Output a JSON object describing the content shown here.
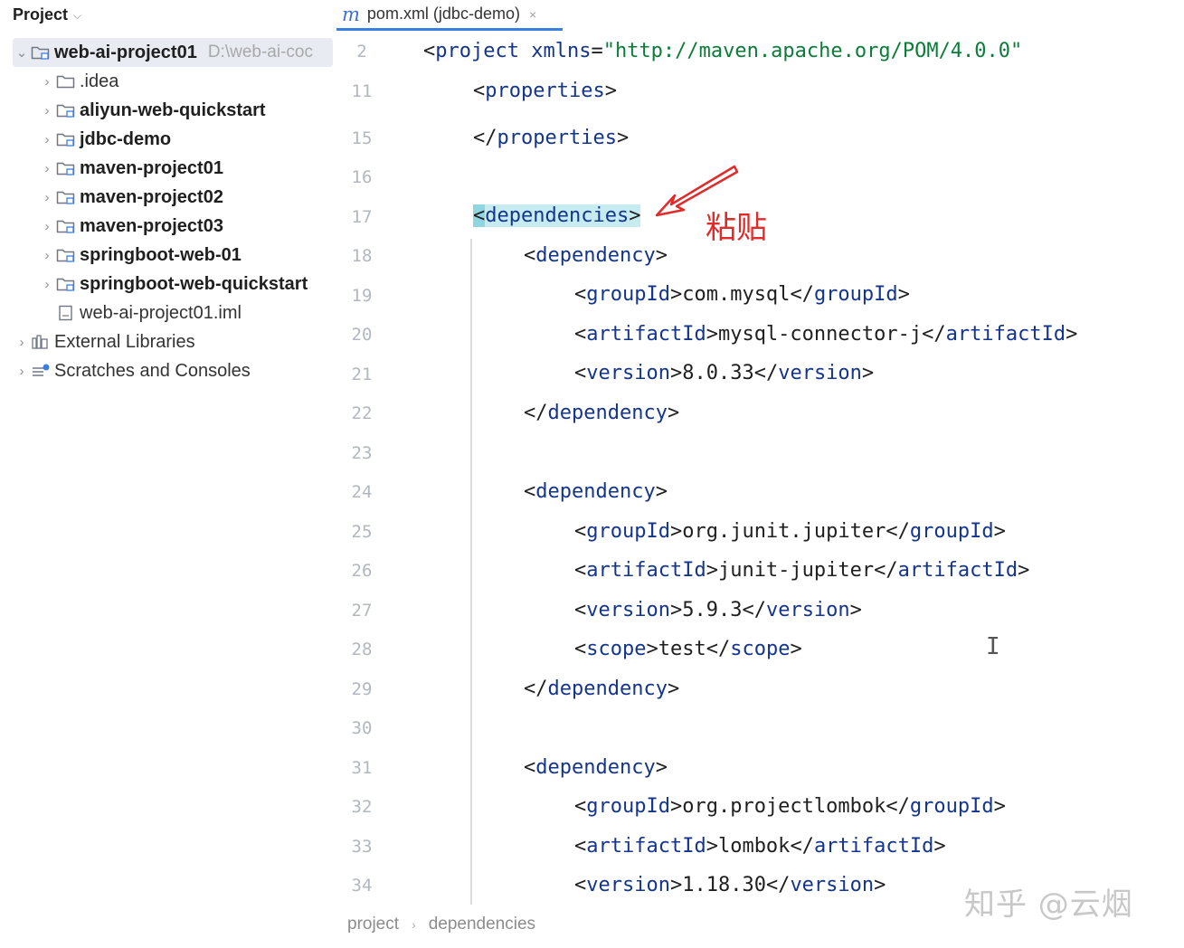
{
  "project_panel": {
    "title": "Project",
    "root": {
      "name": "web-ai-project01",
      "path": "D:\\web-ai-coc"
    },
    "items": [
      {
        "label": ".idea",
        "bold": false,
        "type": "folder"
      },
      {
        "label": "aliyun-web-quickstart",
        "bold": true,
        "type": "module"
      },
      {
        "label": "jdbc-demo",
        "bold": true,
        "type": "module"
      },
      {
        "label": "maven-project01",
        "bold": true,
        "type": "module"
      },
      {
        "label": "maven-project02",
        "bold": true,
        "type": "module"
      },
      {
        "label": "maven-project03",
        "bold": true,
        "type": "module"
      },
      {
        "label": "springboot-web-01",
        "bold": true,
        "type": "module"
      },
      {
        "label": "springboot-web-quickstart",
        "bold": true,
        "type": "module"
      },
      {
        "label": "web-ai-project01.iml",
        "bold": false,
        "type": "file"
      }
    ],
    "extra": [
      {
        "label": "External Libraries"
      },
      {
        "label": "Scratches and Consoles"
      }
    ]
  },
  "tab": {
    "icon_letter": "m",
    "title": "pom.xml (jdbc-demo)",
    "close": "×"
  },
  "editor": {
    "line_numbers": [
      "2",
      "11",
      "15",
      "16",
      "17",
      "18",
      "19",
      "20",
      "21",
      "22",
      "23",
      "24",
      "25",
      "26",
      "27",
      "28",
      "29",
      "30",
      "31",
      "32",
      "33",
      "34"
    ],
    "project_open": "project",
    "xmlns_attr": "xmlns",
    "xmlns_value": "\"http://maven.apache.org/POM/4.0.0\"",
    "properties_tag": "properties",
    "dependencies_tag": "dependencies",
    "dependency_tag": "dependency",
    "groupId_tag": "groupId",
    "artifactId_tag": "artifactId",
    "version_tag": "version",
    "scope_tag": "scope",
    "deps": [
      {
        "groupId": "com.mysql",
        "artifactId": "mysql-connector-j",
        "version": "8.0.33"
      },
      {
        "groupId": "org.junit.jupiter",
        "artifactId": "junit-jupiter",
        "version": "5.9.3",
        "scope": "test"
      },
      {
        "groupId": "org.projectlombok",
        "artifactId": "lombok",
        "version": "1.18.30"
      }
    ]
  },
  "annotation": {
    "text": "粘贴",
    "color": "#e02b2b"
  },
  "breadcrumb": [
    "project",
    "dependencies"
  ],
  "watermark": "知乎 @云烟",
  "colors": {
    "tag": "#14358c",
    "string": "#0b7d39",
    "accent": "#3b7fe0",
    "highlight": "#c6ecf2"
  }
}
